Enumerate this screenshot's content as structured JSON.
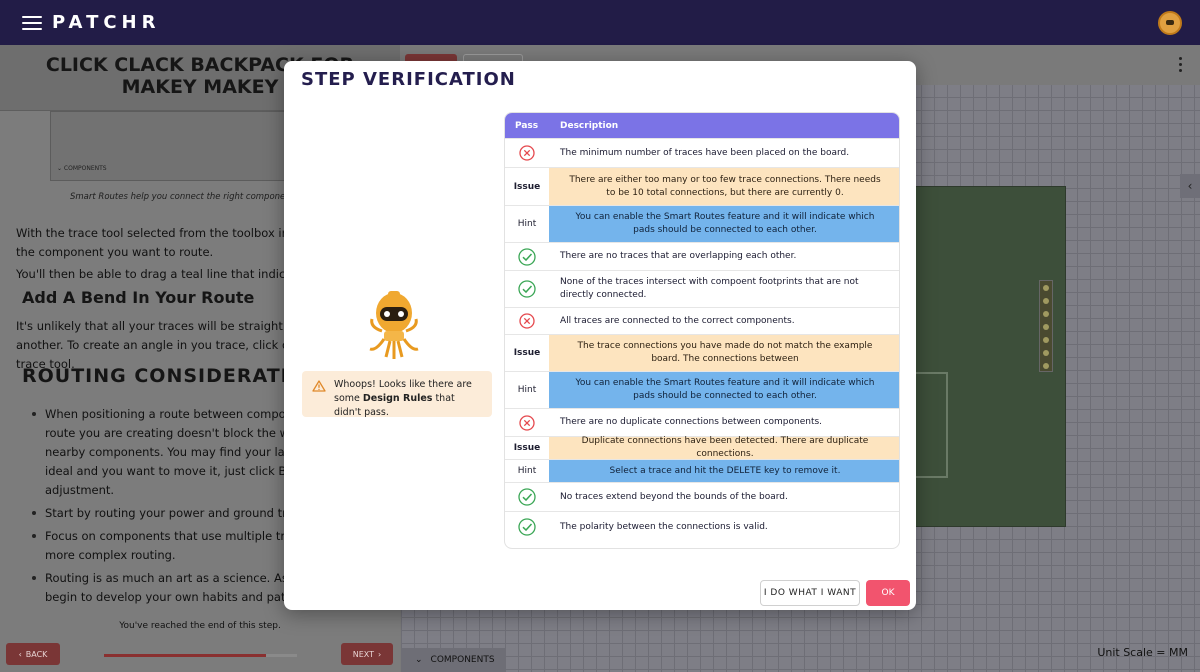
{
  "app": {
    "brand": "PATCHR"
  },
  "lesson": {
    "title": "CLICK CLACK BACKPACK FOR MAKEY MAKEY",
    "thumb_label": "⌄ COMPONENTS",
    "caption": "Smart Routes help you connect the right components while y",
    "para1": "With the trace tool selected from the toolbox in the PCB E of the component you want to route.",
    "para2": "You'll then be able to drag a teal line that indicates the pla",
    "heading_bend": "Add A Bend In Your Route",
    "para3": "It's unlikely that all your traces will be straight lines from another. To create an angle in you trace, click on the PCB trace tool.",
    "heading_routing": "ROUTING CONSIDERATIONS",
    "bullets": [
      "When positioning a route between components, ma route you are creating doesn't block the way for oth nearby components. You may find your layout of a c ideal and you want to move it, just click BACK and r adjustment.",
      "Start by routing your power and ground traces.",
      "Focus on components that use multiple traces, sinc more complex routing.",
      "Routing is as much an art as a science. As you route begin to develop your own habits and patterns. )"
    ],
    "end_note": "You've reached the end of this step.",
    "back_label": "BACK",
    "next_label": "NEXT",
    "progress_fraction": 0.84
  },
  "workspace": {
    "components_tab": "COMPONENTS",
    "unit_scale": "Unit Scale = MM"
  },
  "modal": {
    "title": "STEP VERIFICATION",
    "warning_prefix": "Whoops! Looks like there are some ",
    "warning_bold": "Design Rules",
    "warning_suffix": " that didn't pass.",
    "col_pass": "Pass",
    "col_desc": "Description",
    "rows": [
      {
        "kind": "fail",
        "text": "The minimum number of traces have been placed on the board."
      },
      {
        "kind": "issue",
        "label": "Issue",
        "text": "There are either too many or too few trace connections. There needs to be 10 total connections, but there are currently 0."
      },
      {
        "kind": "hint",
        "label": "Hint",
        "text": "You can enable the Smart Routes feature and it will indicate which pads should be connected to each other."
      },
      {
        "kind": "pass",
        "text": "There are no traces that are overlapping each other."
      },
      {
        "kind": "pass",
        "text": "None of the traces intersect with compoent footprints that are not directly connected."
      },
      {
        "kind": "fail",
        "text": "All traces are connected to the correct components."
      },
      {
        "kind": "issue",
        "label": "Issue",
        "text": "The trace connections you have made do not match the example board. The connections between"
      },
      {
        "kind": "hint",
        "label": "Hint",
        "text": "You can enable the Smart Routes feature and it will indicate which pads should be connected to each other."
      },
      {
        "kind": "fail",
        "text": "There are no duplicate connections between components."
      },
      {
        "kind": "issue",
        "label": "Issue",
        "text": "Duplicate connections have been detected. There are duplicate connections."
      },
      {
        "kind": "hint",
        "label": "Hint",
        "text": "Select a trace and hit the DELETE key to remove it."
      },
      {
        "kind": "pass",
        "text": "No traces extend beyond the bounds of the board."
      },
      {
        "kind": "pass",
        "text": "The polarity between the connections is valid."
      }
    ],
    "btn_want": "I DO WHAT I WANT",
    "btn_ok": "OK",
    "colors": {
      "header": "#7b73e6",
      "issue": "#fde4bf",
      "hint": "#74b4ec",
      "fail": "#e5484d",
      "pass": "#3aa655",
      "ok_button": "#f2546e"
    }
  }
}
